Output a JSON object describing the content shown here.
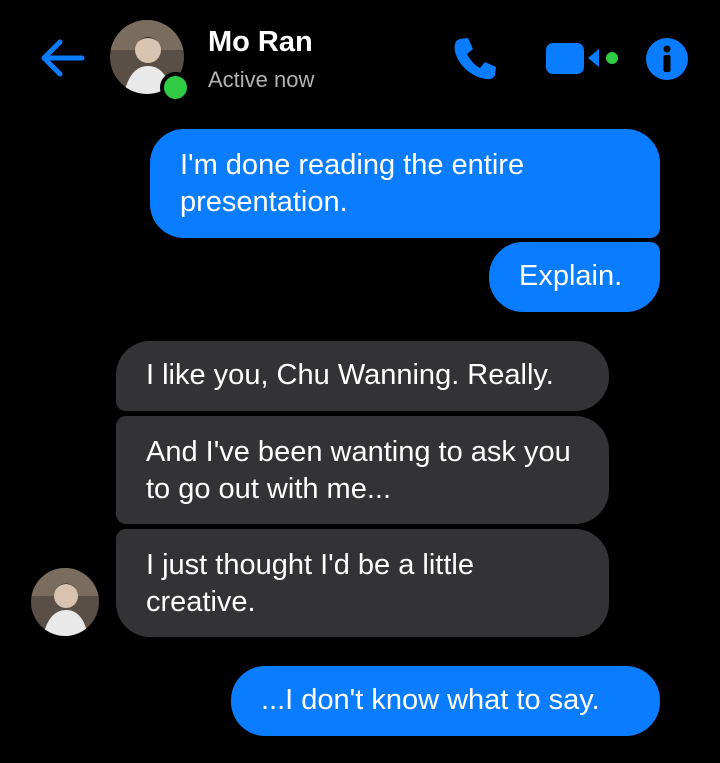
{
  "colors": {
    "accent": "#0a7cff",
    "incoming_bubble": "#333335",
    "online": "#31cc46",
    "background": "#000000"
  },
  "header": {
    "back_icon": "arrow-left-icon",
    "contact_name": "Mo Ran",
    "status": "Active now",
    "actions": [
      {
        "icon": "phone-icon"
      },
      {
        "icon": "video-camera-icon"
      },
      {
        "icon": "info-icon"
      }
    ]
  },
  "messages": [
    {
      "direction": "outgoing",
      "text": "I'm done reading the entire presentation."
    },
    {
      "direction": "outgoing",
      "text": "Explain."
    },
    {
      "direction": "incoming",
      "text": "I like you, Chu Wanning. Really."
    },
    {
      "direction": "incoming",
      "text": "And I've been wanting to ask you to go out with me..."
    },
    {
      "direction": "incoming",
      "text": "I just thought I'd be a little creative."
    },
    {
      "direction": "outgoing",
      "text": "...I don't know what to say."
    }
  ]
}
